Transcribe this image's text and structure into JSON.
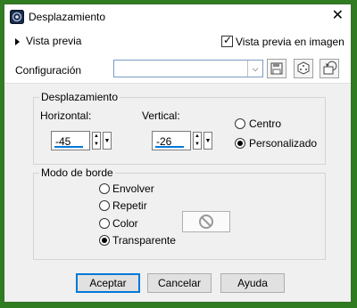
{
  "window": {
    "title": "Desplazamiento"
  },
  "preview": {
    "toggle_label": "Vista previa",
    "checkbox_label": "Vista previa en imagen",
    "checked": true
  },
  "config": {
    "label": "Configuración",
    "value": ""
  },
  "displacement": {
    "group_label": "Desplazamiento",
    "horizontal_label": "Horizontal:",
    "horizontal_value": "-45",
    "vertical_label": "Vertical:",
    "vertical_value": "-26",
    "options": [
      {
        "label": "Centro",
        "selected": false
      },
      {
        "label": "Personalizado",
        "selected": true
      }
    ]
  },
  "border": {
    "group_label": "Modo de borde",
    "options": [
      {
        "label": "Envolver",
        "selected": false
      },
      {
        "label": "Repetir",
        "selected": false
      },
      {
        "label": "Color",
        "selected": false
      },
      {
        "label": "Transparente",
        "selected": true
      }
    ]
  },
  "buttons": {
    "accept": "Aceptar",
    "cancel": "Cancelar",
    "help": "Ayuda"
  },
  "colors": {
    "accent": "#0078d7",
    "frame": "#2f7d20"
  }
}
